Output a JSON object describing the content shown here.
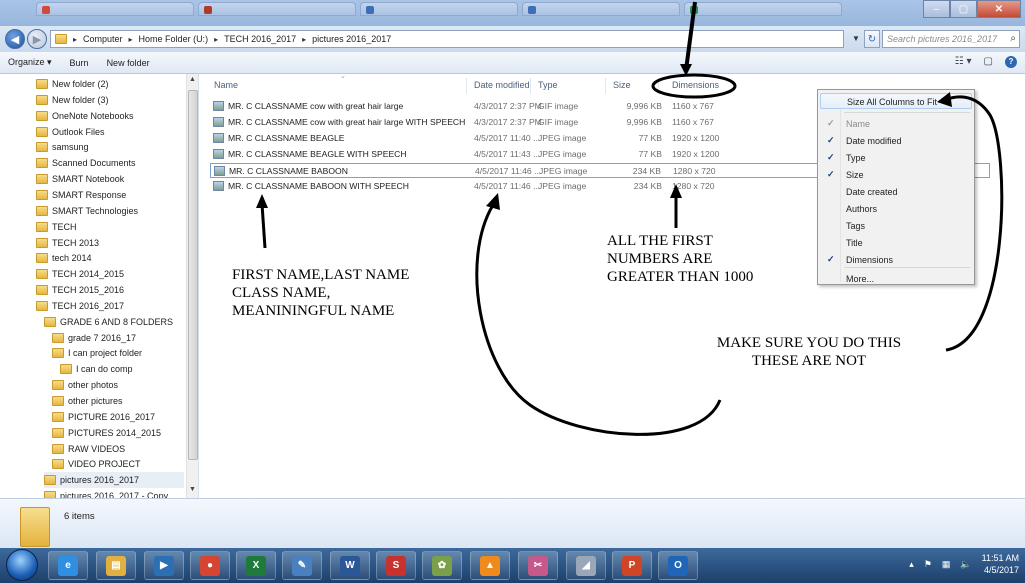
{
  "address": {
    "crumbs": [
      "Computer",
      "Home Folder (U:)",
      "TECH 2016_2017",
      "pictures 2016_2017"
    ],
    "search_placeholder": "Search pictures 2016_2017"
  },
  "toolbar": {
    "organize": "Organize ▾",
    "burn": "Burn",
    "new_folder": "New folder"
  },
  "nav": {
    "items": [
      {
        "label": "New folder (2)",
        "indent": 0
      },
      {
        "label": "New folder (3)",
        "indent": 0
      },
      {
        "label": "OneNote Notebooks",
        "indent": 0
      },
      {
        "label": "Outlook Files",
        "indent": 0
      },
      {
        "label": "samsung",
        "indent": 0
      },
      {
        "label": "Scanned Documents",
        "indent": 0
      },
      {
        "label": "SMART Notebook",
        "indent": 0
      },
      {
        "label": "SMART Response",
        "indent": 0
      },
      {
        "label": "SMART Technologies",
        "indent": 0
      },
      {
        "label": "TECH",
        "indent": 0
      },
      {
        "label": "TECH 2013",
        "indent": 0
      },
      {
        "label": "tech 2014",
        "indent": 0
      },
      {
        "label": "TECH 2014_2015",
        "indent": 0
      },
      {
        "label": "TECH 2015_2016",
        "indent": 0
      },
      {
        "label": "TECH 2016_2017",
        "indent": 0
      },
      {
        "label": "GRADE 6 AND 8 FOLDERS",
        "indent": 1
      },
      {
        "label": "grade 7 2016_17",
        "indent": 2
      },
      {
        "label": "I can project folder",
        "indent": 2
      },
      {
        "label": "I can do comp",
        "indent": 3
      },
      {
        "label": "other photos",
        "indent": 2
      },
      {
        "label": "other pictures",
        "indent": 2
      },
      {
        "label": "PICTURE 2016_2017",
        "indent": 2
      },
      {
        "label": "PICTURES 2014_2015",
        "indent": 2
      },
      {
        "label": "RAW VIDEOS",
        "indent": 2
      },
      {
        "label": "VIDEO PROJECT",
        "indent": 2
      },
      {
        "label": "pictures 2016_2017",
        "indent": 1,
        "selected": true
      },
      {
        "label": "pictures 2016_2017 - Copy",
        "indent": 1
      }
    ]
  },
  "columns": {
    "name": "Name",
    "date": "Date modified",
    "type": "Type",
    "size": "Size",
    "dimensions": "Dimensions"
  },
  "files": [
    {
      "name": "MR. C CLASSNAME cow with great hair large",
      "date": "4/3/2017 2:37 PM",
      "type": "GIF image",
      "size": "9,996 KB",
      "dims": "1160 x 767"
    },
    {
      "name": "MR. C CLASSNAME cow with great hair large WITH SPEECH",
      "date": "4/3/2017 2:37 PM",
      "type": "GIF image",
      "size": "9,996 KB",
      "dims": "1160 x 767"
    },
    {
      "name": "MR. C CLASSNAME BEAGLE",
      "date": "4/5/2017 11:40 ...",
      "type": "JPEG image",
      "size": "77 KB",
      "dims": "1920 x 1200"
    },
    {
      "name": "MR. C CLASSNAME BEAGLE WITH SPEECH",
      "date": "4/5/2017 11:43 ...",
      "type": "JPEG image",
      "size": "77 KB",
      "dims": "1920 x 1200"
    },
    {
      "name": "MR. C CLASSNAME BABOON",
      "date": "4/5/2017 11:46 ...",
      "type": "JPEG image",
      "size": "234 KB",
      "dims": "1280 x 720",
      "selected": true
    },
    {
      "name": "MR. C CLASSNAME BABOON WITH SPEECH",
      "date": "4/5/2017 11:46 ...",
      "type": "JPEG image",
      "size": "234 KB",
      "dims": "1280 x 720"
    }
  ],
  "context_menu": {
    "items": [
      {
        "label": "Size All Columns to Fit",
        "checked": false,
        "hot": true
      },
      {
        "label": "Name",
        "checked": true,
        "disabled": true
      },
      {
        "label": "Date modified",
        "checked": true
      },
      {
        "label": "Type",
        "checked": true
      },
      {
        "label": "Size",
        "checked": true
      },
      {
        "label": "Date created",
        "checked": false
      },
      {
        "label": "Authors",
        "checked": false
      },
      {
        "label": "Tags",
        "checked": false
      },
      {
        "label": "Title",
        "checked": false
      },
      {
        "label": "Dimensions",
        "checked": true
      },
      {
        "label": "More...",
        "checked": false
      }
    ]
  },
  "details": {
    "count": "6 items"
  },
  "taskbar": {
    "apps": [
      {
        "icon": "internet-explorer-icon",
        "glyph": "e",
        "color": "#2f8fe0"
      },
      {
        "icon": "file-explorer-icon",
        "glyph": "▤",
        "color": "#e0b040"
      },
      {
        "icon": "media-player-icon",
        "glyph": "▶",
        "color": "#2c6fb3"
      },
      {
        "icon": "chrome-icon",
        "glyph": "●",
        "color": "#d64532"
      },
      {
        "icon": "excel-icon",
        "glyph": "X",
        "color": "#1f7a3c"
      },
      {
        "icon": "notes-icon",
        "glyph": "✎",
        "color": "#4a7fc0"
      },
      {
        "icon": "word-icon",
        "glyph": "W",
        "color": "#2b5797"
      },
      {
        "icon": "sketchup-icon",
        "glyph": "S",
        "color": "#c8322e"
      },
      {
        "icon": "paint-icon",
        "glyph": "✿",
        "color": "#7ba04a"
      },
      {
        "icon": "vlc-icon",
        "glyph": "▲",
        "color": "#f08a1c"
      },
      {
        "icon": "snipping-tool-icon",
        "glyph": "✂",
        "color": "#c55a8a"
      },
      {
        "icon": "sketch-app-icon",
        "glyph": "◢",
        "color": "#9aa7b8"
      },
      {
        "icon": "powerpoint-icon",
        "glyph": "P",
        "color": "#d04526"
      },
      {
        "icon": "outlook-icon",
        "glyph": "O",
        "color": "#1f65b8"
      }
    ],
    "time": "11:51 AM",
    "date": "4/5/2017"
  },
  "annotations": {
    "naming": [
      "FIRST NAME,LAST NAME",
      "CLASS NAME,",
      "MEANININGFUL NAME"
    ],
    "numbers": [
      "ALL THE FIRST",
      "NUMBERS ARE",
      "GREATER THAN 1000"
    ],
    "make_sure": [
      "MAKE SURE YOU DO THIS",
      "THESE ARE NOT"
    ]
  }
}
